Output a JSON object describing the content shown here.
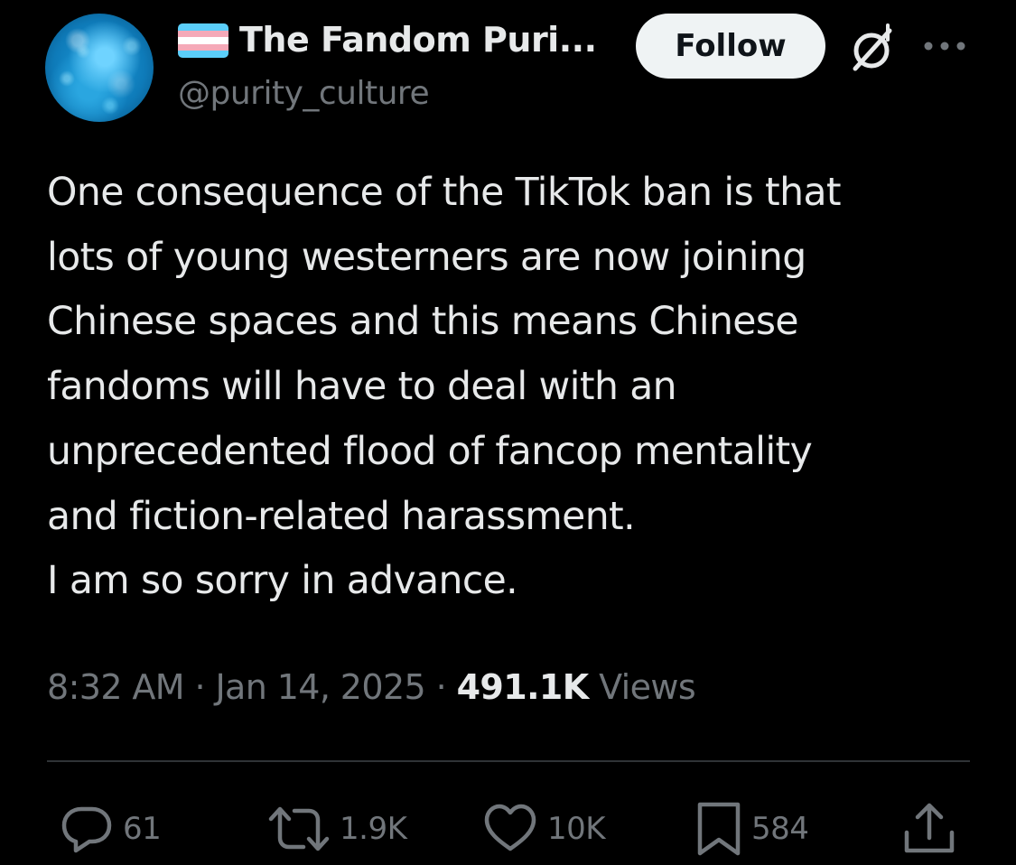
{
  "author": {
    "display_name": "The Fandom Puri...",
    "handle": "@purity_culture",
    "flag_colors": [
      "#5bcefa",
      "#f5a9b8",
      "#ffffff",
      "#f5a9b8",
      "#5bcefa"
    ]
  },
  "header": {
    "follow_label": "Follow",
    "grok_icon": "grok-icon",
    "more_icon": "more-options-icon"
  },
  "tweet": {
    "text": "One consequence of the TikTok ban is that\nlots of young westerners are now joining\nChinese spaces and this means Chinese\nfandoms will have to deal with an\nunprecedented flood of fancop mentality\nand fiction-related harassment.\nI am so sorry in advance."
  },
  "meta": {
    "time": "8:32 AM",
    "separator": " · ",
    "date": "Jan 14, 2025",
    "views_count": "491.1K",
    "views_label": " Views"
  },
  "actions": {
    "replies": "61",
    "reposts": "1.9K",
    "likes": "10K",
    "bookmarks": "584"
  },
  "colors": {
    "background": "#000000",
    "text_primary": "#e7e9ea",
    "text_secondary": "#71767b",
    "divider": "#2f3336",
    "follow_bg": "#eff3f4"
  }
}
